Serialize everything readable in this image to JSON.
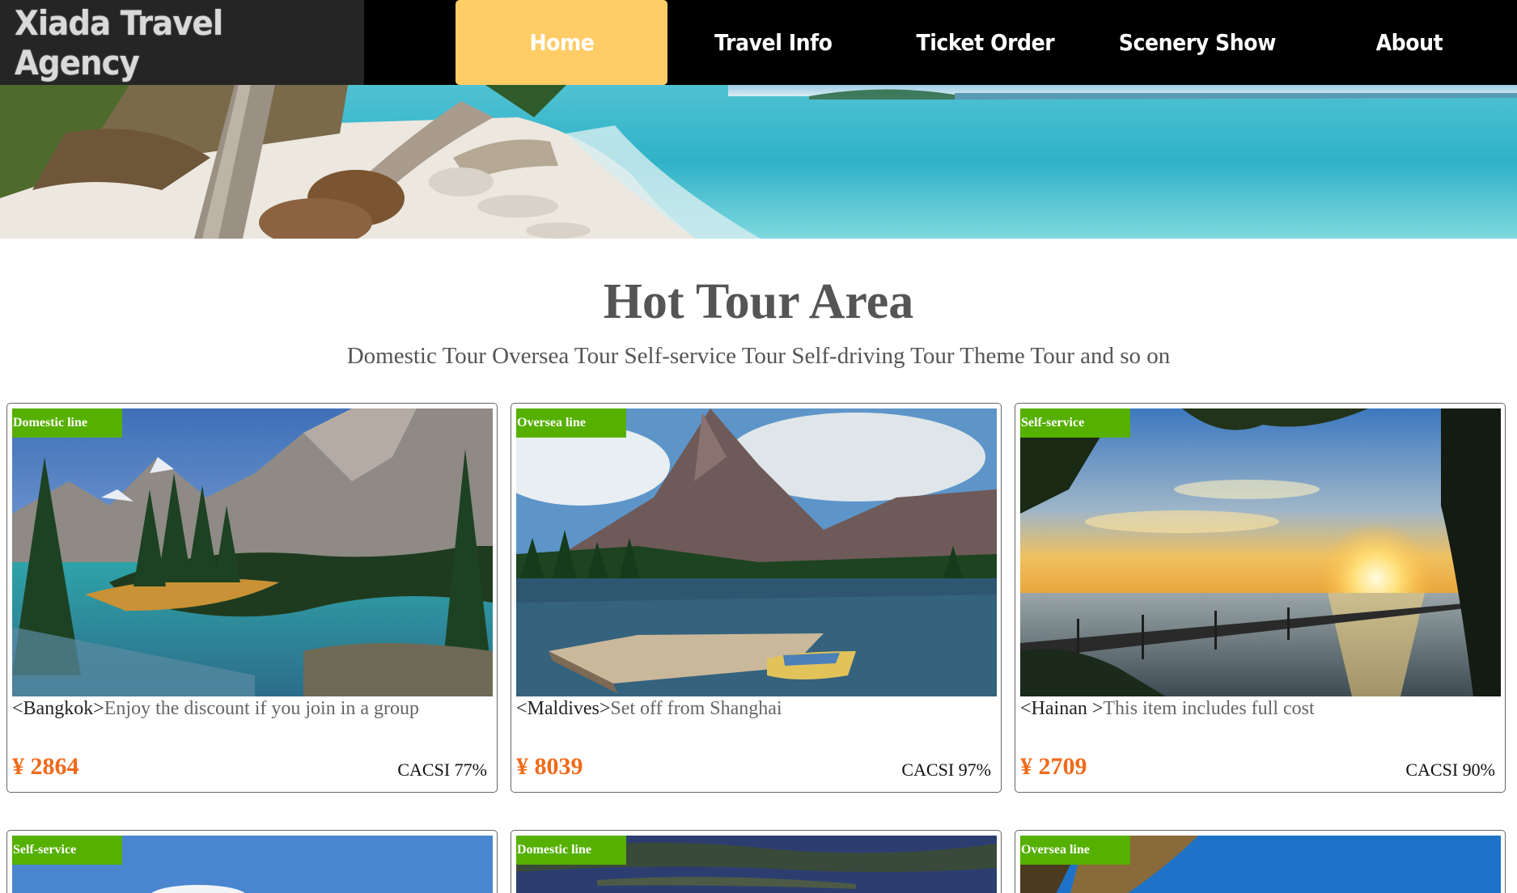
{
  "brand": "Xiada Travel Agency",
  "nav": [
    {
      "label": "Home",
      "active": true
    },
    {
      "label": "Travel Info"
    },
    {
      "label": "Ticket Order"
    },
    {
      "label": "Scenery Show"
    },
    {
      "label": "About"
    }
  ],
  "title": "Hot Tour Area",
  "subtitle": "Domestic Tour Oversea Tour Self-service Tour Self-driving Tour Theme Tour and so on",
  "cards": [
    {
      "tag": "Domestic line",
      "place": "<Bangkok>",
      "text": "Enjoy the discount if you join in a group",
      "price": "¥ 2864",
      "cacsi": "CACSI 77%"
    },
    {
      "tag": "Oversea line",
      "place": "<Maldives>",
      "text": "Set off from Shanghai",
      "price": "¥ 8039",
      "cacsi": "CACSI 97%"
    },
    {
      "tag": "Self-service",
      "place": "<Hainan >",
      "text": "This item includes full cost",
      "price": "¥ 2709",
      "cacsi": "CACSI 90%"
    },
    {
      "tag": "Self-service"
    },
    {
      "tag": "Domestic line"
    },
    {
      "tag": "Oversea line"
    }
  ],
  "colors": {
    "accent": "#ffcc66",
    "tag": "#55b000",
    "price": "#f06a1a",
    "navbar": "#000000"
  }
}
